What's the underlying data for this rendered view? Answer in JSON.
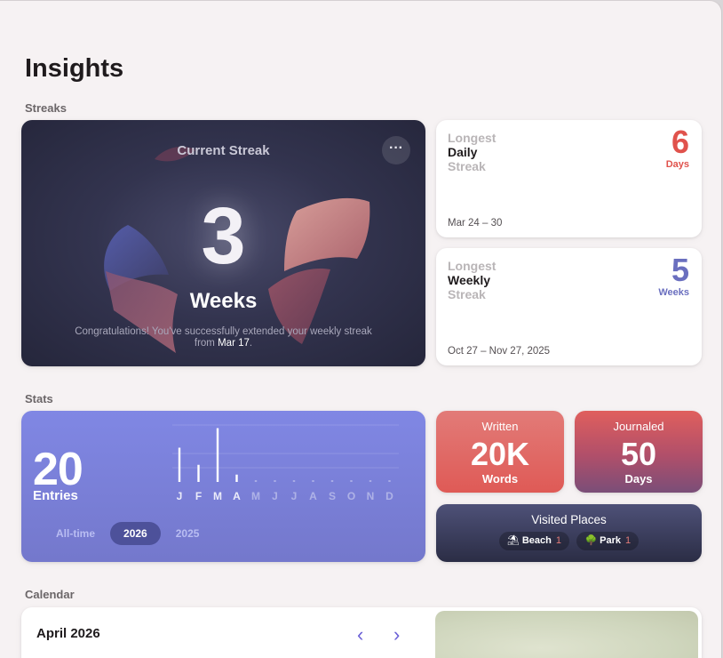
{
  "page": {
    "title": "Insights"
  },
  "sections": {
    "streaks": "Streaks",
    "stats": "Stats",
    "calendar": "Calendar"
  },
  "current_streak": {
    "title": "Current Streak",
    "more_icon": "ellipsis-icon",
    "more_glyph": "···",
    "value": "3",
    "unit": "Weeks",
    "message_prefix": "Congratulations! You've successfully extended your weekly streak from ",
    "message_date": "Mar 17",
    "message_suffix": "."
  },
  "longest_daily": {
    "line1": "Longest",
    "line2": "Daily",
    "line3": "Streak",
    "value": "6",
    "unit": "Days",
    "date_range": "Mar 24 – 30",
    "color": "#e0524c"
  },
  "longest_weekly": {
    "line1": "Longest",
    "line2": "Weekly",
    "line3": "Streak",
    "value": "5",
    "unit": "Weeks",
    "date_range": "Oct 27 – Nov 27, 2025",
    "color": "#6a6fbf"
  },
  "entries": {
    "value": "20",
    "label": "Entries",
    "filters": [
      "All-time",
      "2026",
      "2025"
    ],
    "selected_filter": "2026",
    "chart_data": {
      "type": "bar",
      "categories": [
        "J",
        "F",
        "M",
        "A",
        "M",
        "J",
        "J",
        "A",
        "S",
        "O",
        "N",
        "D"
      ],
      "values": [
        7,
        3.5,
        11,
        1.5,
        0,
        0,
        0,
        0,
        0,
        0,
        0,
        0
      ]
    }
  },
  "written": {
    "label": "Written",
    "value": "20K",
    "unit": "Words"
  },
  "journaled": {
    "label": "Journaled",
    "value": "50",
    "unit": "Days"
  },
  "visited_places": {
    "title": "Visited Places",
    "places": [
      {
        "icon": "umbrella-icon",
        "glyph": "⛱",
        "name": "Beach",
        "count": "1"
      },
      {
        "icon": "tree-icon",
        "glyph": "🌳",
        "name": "Park",
        "count": "1"
      }
    ]
  },
  "calendar": {
    "month": "April 2026",
    "prev_glyph": "‹",
    "next_glyph": "›"
  },
  "colors": {
    "accent": "#6a5fd6",
    "streak_bg": "#2c2d45",
    "entries_bg": "#7b80d9",
    "written_bg": "#e06a66"
  }
}
